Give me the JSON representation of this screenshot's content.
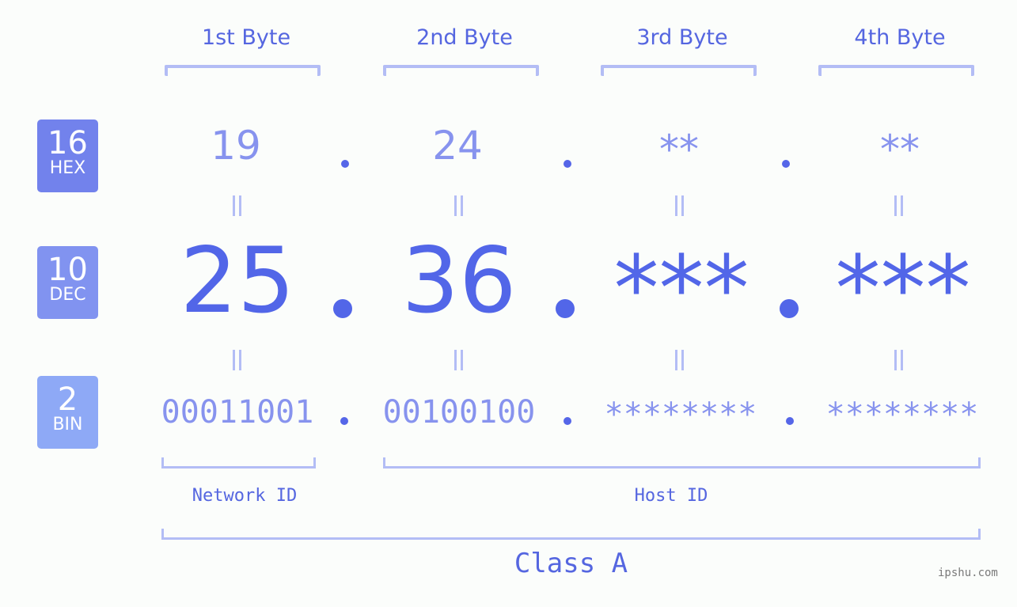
{
  "bytes": {
    "headers": [
      "1st Byte",
      "2nd Byte",
      "3rd Byte",
      "4th Byte"
    ],
    "hex": [
      "19",
      "24",
      "**",
      "**"
    ],
    "dec": [
      "25",
      "36",
      "***",
      "***"
    ],
    "bin": [
      "00011001",
      "00100100",
      "********",
      "********"
    ]
  },
  "badges": {
    "hex": {
      "num": "16",
      "label": "HEX",
      "color": "#7282ec"
    },
    "dec": {
      "num": "10",
      "label": "DEC",
      "color": "#8193f0"
    },
    "bin": {
      "num": "2",
      "label": "BIN",
      "color": "#8ea9f6"
    }
  },
  "segments": {
    "network": "Network ID",
    "host": "Host ID",
    "class": "Class A"
  },
  "watermark": "ipshu.com",
  "colors": {
    "accent": "#5266e8",
    "light": "#8793ee",
    "bracket": "#b3bdf5"
  }
}
